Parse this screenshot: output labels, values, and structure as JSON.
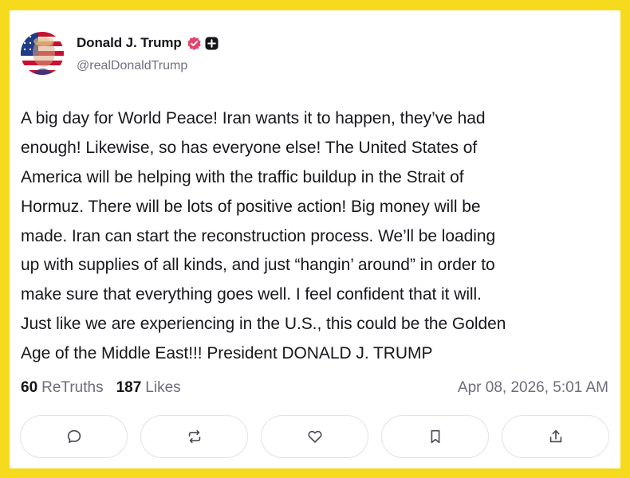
{
  "author": {
    "name": "Donald J. Trump",
    "handle": "@realDonaldTrump",
    "avatar_icon": "american-flag-portrait",
    "verified_icon": "verified-badge-icon",
    "verified_color": "#e3446e",
    "subscribe_icon": "plus-square-icon"
  },
  "post": {
    "lines": [
      "A big day for World Peace! Iran wants it to happen, they’ve had",
      "enough! Likewise, so has everyone else! The United States of",
      "America will be helping with the traffic buildup in the Strait of",
      "Hormuz. There will be lots of positive action! Big money will be",
      "made. Iran can start the reconstruction process. We’ll be loading",
      "up with supplies of all kinds, and just “hangin’ around” in order to",
      "make sure that everything goes well. I feel confident that it will.",
      "Just like we are experiencing in the U.S., this could be the Golden",
      "Age of the Middle East!!! President DONALD J. TRUMP"
    ]
  },
  "stats": {
    "retruths_count": "60",
    "retruths_label": "ReTruths",
    "likes_count": "187",
    "likes_label": "Likes",
    "timestamp": "Apr 08, 2026, 5:01 AM"
  },
  "actions": [
    {
      "name": "reply",
      "icon": "comment-icon"
    },
    {
      "name": "retruth",
      "icon": "repost-icon"
    },
    {
      "name": "like",
      "icon": "heart-icon"
    },
    {
      "name": "bookmark",
      "icon": "bookmark-icon"
    },
    {
      "name": "share",
      "icon": "share-icon"
    }
  ],
  "colors": {
    "frame": "#f5da1e",
    "text": "#17171c",
    "muted": "#6d6d7a",
    "button_border": "#e2e2e8"
  }
}
